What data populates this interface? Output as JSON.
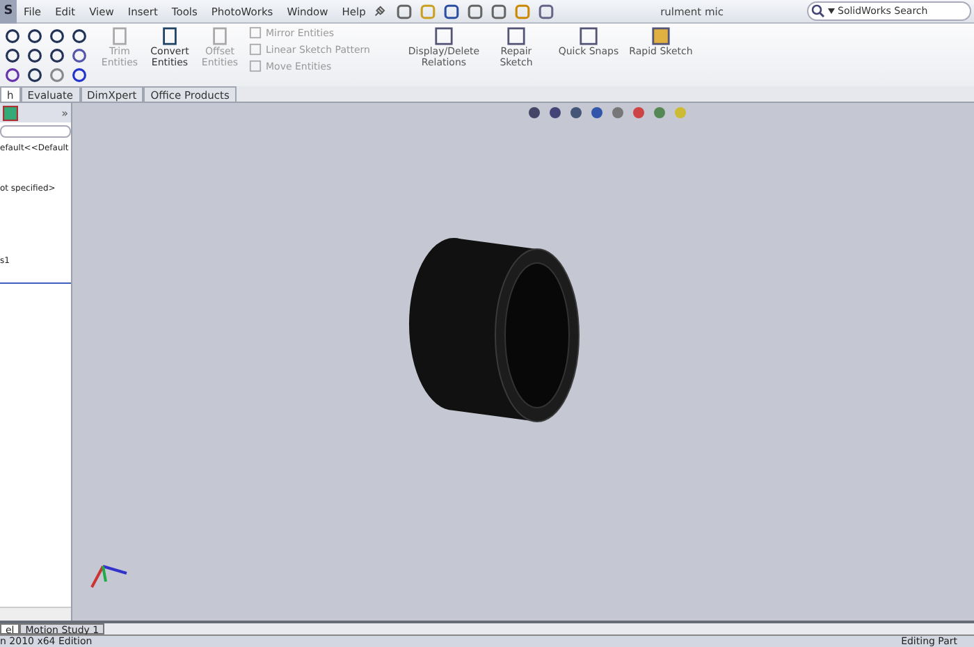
{
  "title_bar": {
    "logo": "S",
    "menus": [
      "File",
      "Edit",
      "View",
      "Insert",
      "Tools",
      "PhotoWorks",
      "Window",
      "Help"
    ],
    "document_title": "rulment mic",
    "search": {
      "placeholder": "SolidWorks Search"
    }
  },
  "ribbon": {
    "large_tools": [
      {
        "label": "Trim Entities",
        "disabled": true
      },
      {
        "label": "Convert Entities",
        "disabled": false
      },
      {
        "label": "Offset Entities",
        "disabled": true
      }
    ],
    "small_tools": [
      {
        "label": "Mirror Entities"
      },
      {
        "label": "Linear Sketch Pattern"
      },
      {
        "label": "Move Entities"
      }
    ],
    "right_tools": [
      {
        "label": "Display/Delete Relations"
      },
      {
        "label": "Repair Sketch"
      },
      {
        "label": "Quick Snaps"
      },
      {
        "label": "Rapid Sketch"
      }
    ]
  },
  "command_tabs": [
    {
      "label": "h",
      "selected": true
    },
    {
      "label": "Evaluate",
      "selected": false
    },
    {
      "label": "DimXpert",
      "selected": false
    },
    {
      "label": "Office Products",
      "selected": false
    }
  ],
  "panel": {
    "expand": "»",
    "lines": [
      "efault<<Default",
      "ot specified>",
      "s1"
    ]
  },
  "bottom_tabs": [
    {
      "label": "el",
      "selected": true
    },
    {
      "label": "Motion Study 1",
      "selected": false
    }
  ],
  "status_bar": {
    "left": "n 2010 x64 Edition",
    "right": "Editing Part"
  }
}
